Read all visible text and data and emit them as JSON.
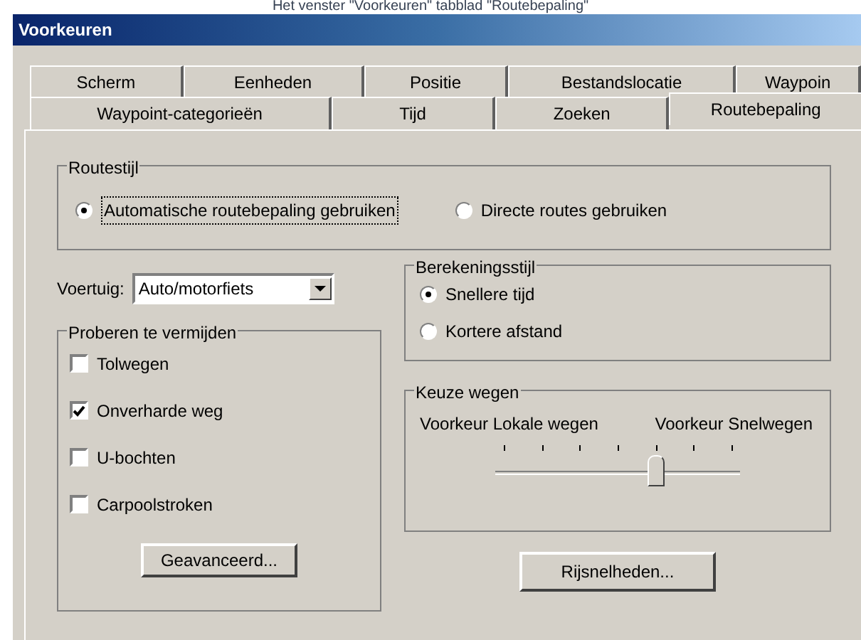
{
  "caption": "Het venster \"Voorkeuren\" tabblad \"Routebepaling\"",
  "window": {
    "title": "Voorkeuren"
  },
  "tab_rows": [
    {
      "tabs": [
        {
          "label": "Scherm",
          "selected": false
        },
        {
          "label": "Eenheden",
          "selected": false
        },
        {
          "label": "Positie",
          "selected": false
        },
        {
          "label": "Bestandslocatie",
          "selected": false
        },
        {
          "label": "Waypoin",
          "selected": false
        }
      ]
    },
    {
      "tabs": [
        {
          "label": "Waypoint-categorieën",
          "selected": false
        },
        {
          "label": "Tijd",
          "selected": false
        },
        {
          "label": "Zoeken",
          "selected": false
        },
        {
          "label": "Routebepaling",
          "selected": true
        }
      ]
    }
  ],
  "route_style": {
    "title": "Routestijl",
    "options": [
      {
        "label": "Automatische routebepaling gebruiken",
        "selected": true
      },
      {
        "label": "Directe routes gebruiken",
        "selected": false
      }
    ]
  },
  "vehicle": {
    "label": "Voertuig:",
    "value": "Auto/motorfiets"
  },
  "avoid": {
    "title": "Proberen te vermijden",
    "items": [
      {
        "label": "Tolwegen",
        "checked": false
      },
      {
        "label": "Onverharde weg",
        "checked": true
      },
      {
        "label": "U-bochten",
        "checked": false
      },
      {
        "label": "Carpoolstroken",
        "checked": false
      }
    ],
    "button": "Geavanceerd..."
  },
  "calculation": {
    "title": "Berekeningsstijl",
    "options": [
      {
        "label": "Snellere tijd",
        "selected": true
      },
      {
        "label": "Kortere afstand",
        "selected": false
      }
    ]
  },
  "road_choice": {
    "title": "Keuze wegen",
    "left_label": "Voorkeur Lokale wegen",
    "right_label": "Voorkeur Snelwegen",
    "level": 0.667
  },
  "speeds_button": "Rijsnelheden..."
}
